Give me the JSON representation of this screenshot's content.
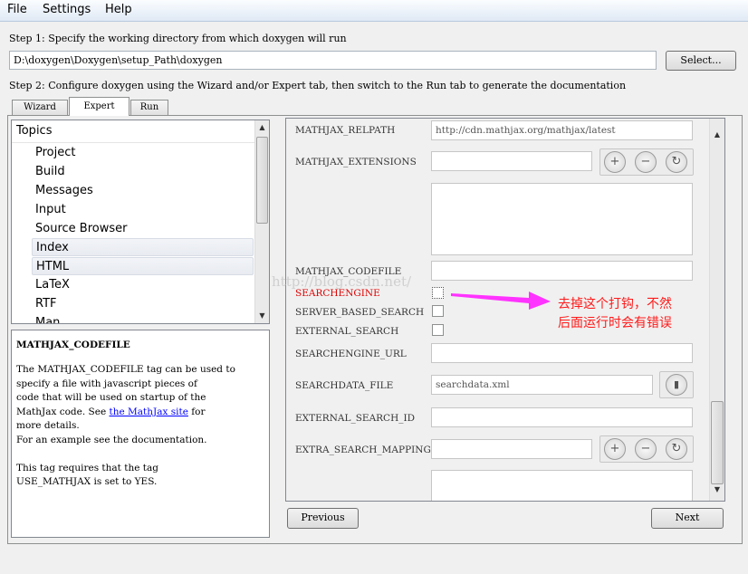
{
  "menu": {
    "file": "File",
    "settings": "Settings",
    "help": "Help"
  },
  "step1": {
    "label": "Step 1: Specify the working directory from which doxygen will run",
    "path_value": "D:\\doxygen\\Doxygen\\setup_Path\\doxygen",
    "select_label": "Select..."
  },
  "step2": {
    "label": "Step 2: Configure doxygen using the Wizard and/or Expert tab, then switch to the Run tab to generate the documentation"
  },
  "tabs": {
    "wizard": "Wizard",
    "expert": "Expert",
    "run": "Run"
  },
  "topics": {
    "header": "Topics",
    "items": [
      "Project",
      "Build",
      "Messages",
      "Input",
      "Source Browser",
      "Index",
      "HTML",
      "LaTeX",
      "RTF",
      "Man"
    ],
    "selected": "Index"
  },
  "help": {
    "title": "MATHJAX_CODEFILE",
    "body1": "The MATHJAX_CODEFILE tag can be used to\nspecify a file with javascript pieces of\ncode that will be used on startup of the\nMathJax code. See ",
    "link": "the MathJax site",
    "body2": " for\nmore details.\nFor an example see the documentation.\n\nThis tag requires that the tag\nUSE_MATHJAX is set to YES."
  },
  "options": {
    "mathjax_relpath": {
      "label": "MATHJAX_RELPATH",
      "value": "http://cdn.mathjax.org/mathjax/latest"
    },
    "mathjax_extensions": {
      "label": "MATHJAX_EXTENSIONS"
    },
    "mathjax_codefile": {
      "label": "MATHJAX_CODEFILE",
      "value": ""
    },
    "searchengine": {
      "label": "SEARCHENGINE",
      "checked": false
    },
    "server_based_search": {
      "label": "SERVER_BASED_SEARCH",
      "checked": false
    },
    "external_search": {
      "label": "EXTERNAL_SEARCH",
      "checked": false
    },
    "searchengine_url": {
      "label": "SEARCHENGINE_URL",
      "value": ""
    },
    "searchdata_file": {
      "label": "SEARCHDATA_FILE",
      "value": "searchdata.xml"
    },
    "external_search_id": {
      "label": "EXTERNAL_SEARCH_ID",
      "value": ""
    },
    "extra_search_mappings": {
      "label": "EXTRA_SEARCH_MAPPINGS"
    }
  },
  "icons": {
    "add": "plus-icon",
    "remove": "minus-icon",
    "reset": "refresh-icon",
    "file": "file-icon"
  },
  "nav": {
    "previous": "Previous",
    "next": "Next"
  },
  "annotation": {
    "line1": "去掉这个打钩，不然",
    "line2": "后面运行时会有错误",
    "color": "#ff1a1a",
    "arrow_color": "#ff33ff"
  },
  "watermark": "http://blog.csdn.net/"
}
